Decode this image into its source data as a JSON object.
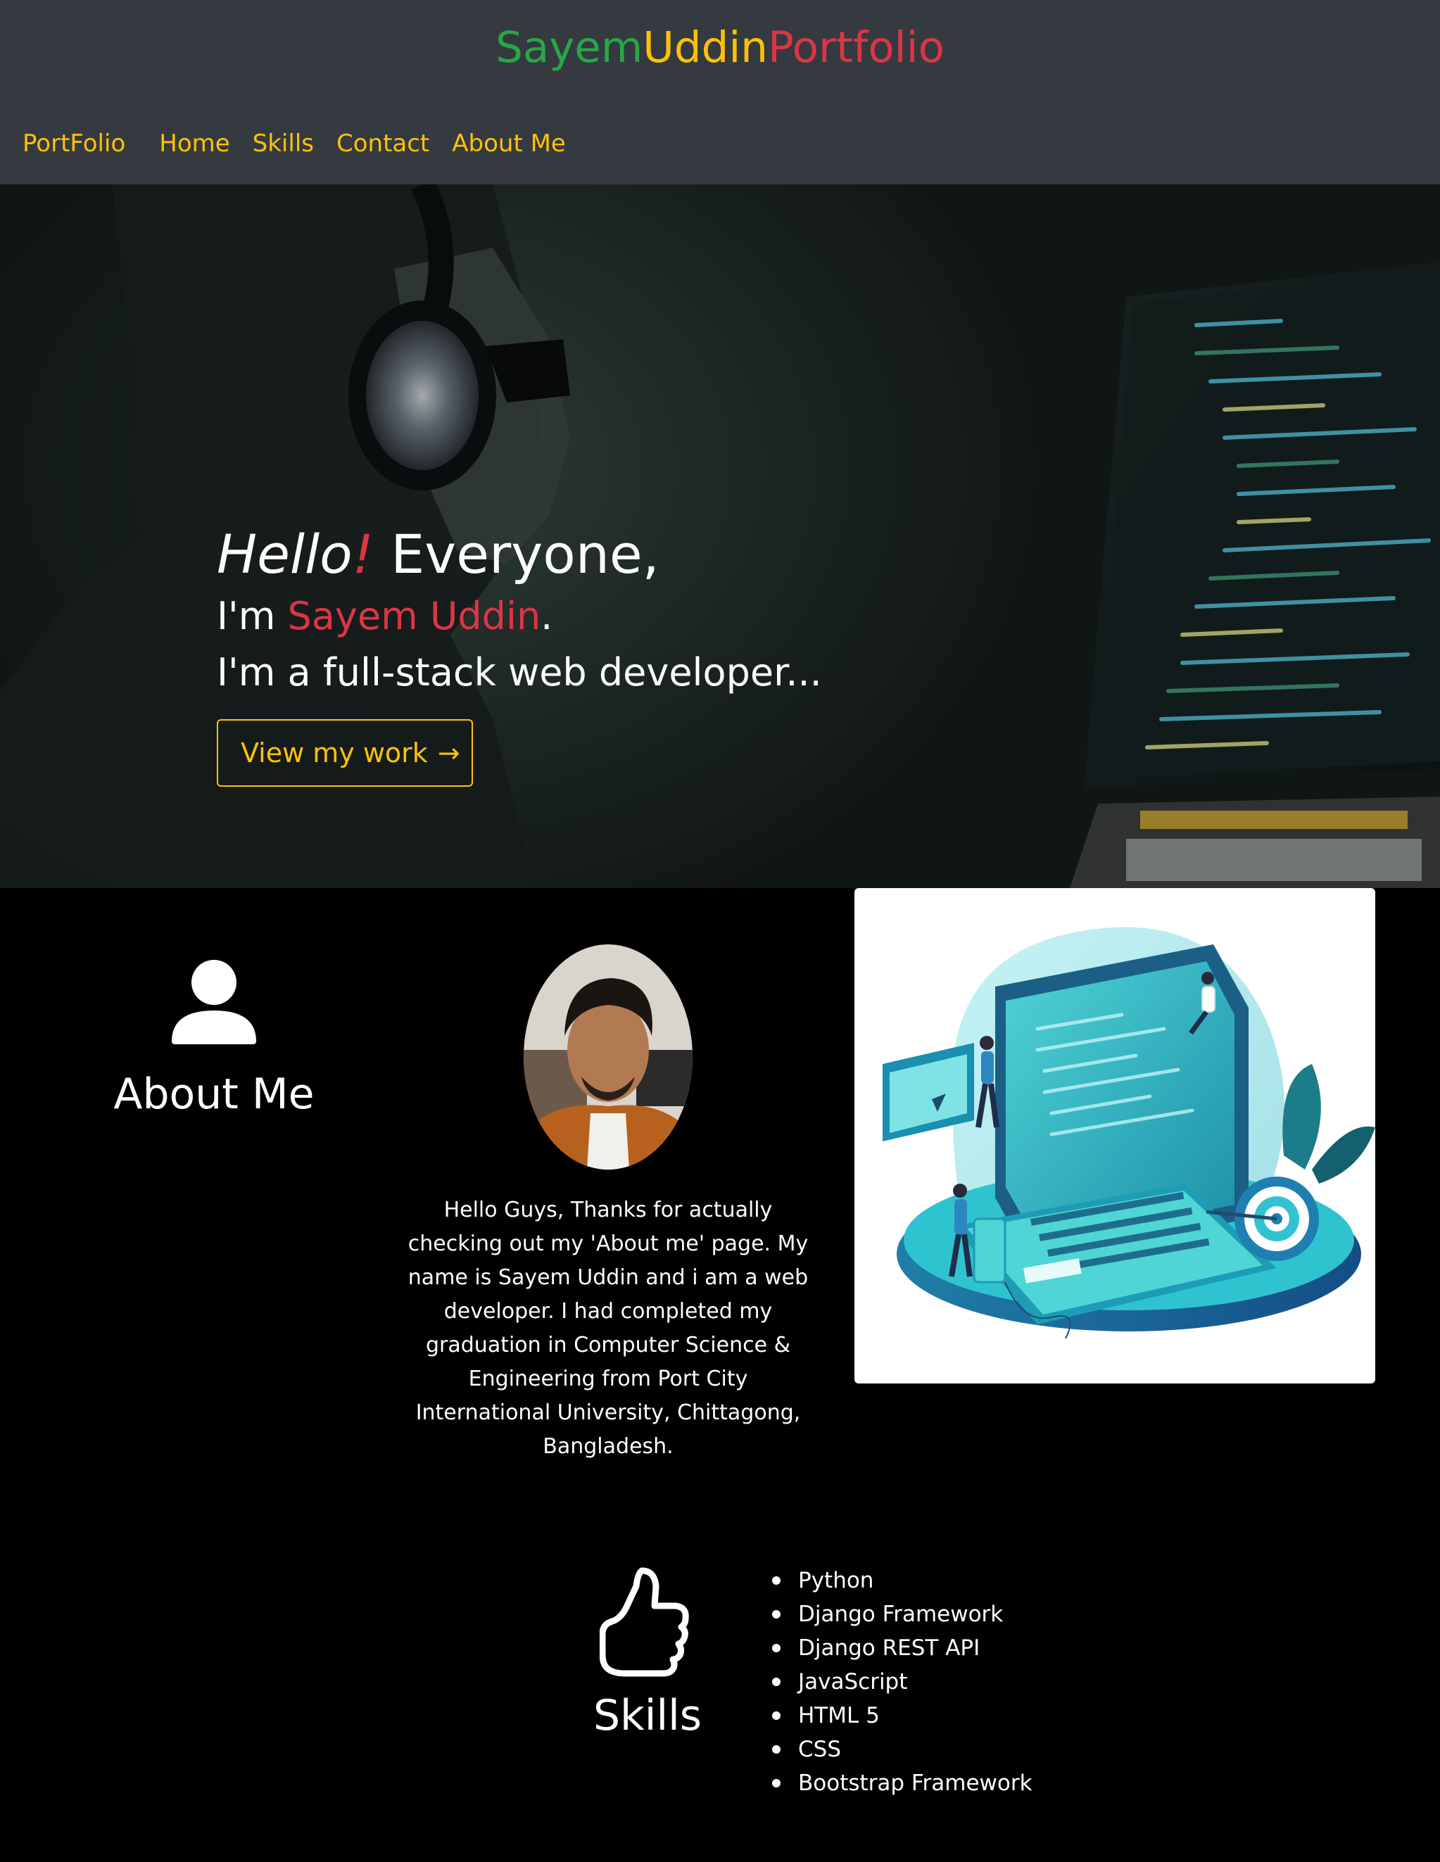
{
  "colors": {
    "header_bg": "#343a40",
    "accent_yellow": "#ffc107",
    "accent_red": "#dc3545",
    "accent_green": "#28a745",
    "page_bg": "#000000",
    "text_white": "#ffffff"
  },
  "header": {
    "brand": {
      "part1": "Sayem",
      "part2": "Uddin",
      "part3": "Portfolio"
    },
    "nav": {
      "brand": "PortFolio",
      "items": [
        "Home",
        "Skills",
        "Contact",
        "About Me"
      ]
    }
  },
  "hero": {
    "hello": "Hello",
    "bang": "!",
    "everyone": " Everyone,",
    "im": "I'm ",
    "name": "Sayem Uddin",
    "period": ".",
    "tagline": "I'm a full-stack web developer...",
    "button_label": "View my work",
    "button_arrow": "→"
  },
  "about": {
    "icon": "person-fill-icon",
    "title": "About Me",
    "text": "Hello Guys, Thanks for actually checking out my 'About me' page. My name is Sayem Uddin and i am a web developer. I had completed my graduation in Computer Science & Engineering from Port City International University, Chittagong, Bangladesh."
  },
  "skills": {
    "icon": "hand-thumbs-up-icon",
    "title": "Skills",
    "items": [
      "Python",
      "Django Framework",
      "Django REST API",
      "JavaScript",
      "HTML 5",
      "CSS",
      "Bootstrap Framework"
    ]
  }
}
